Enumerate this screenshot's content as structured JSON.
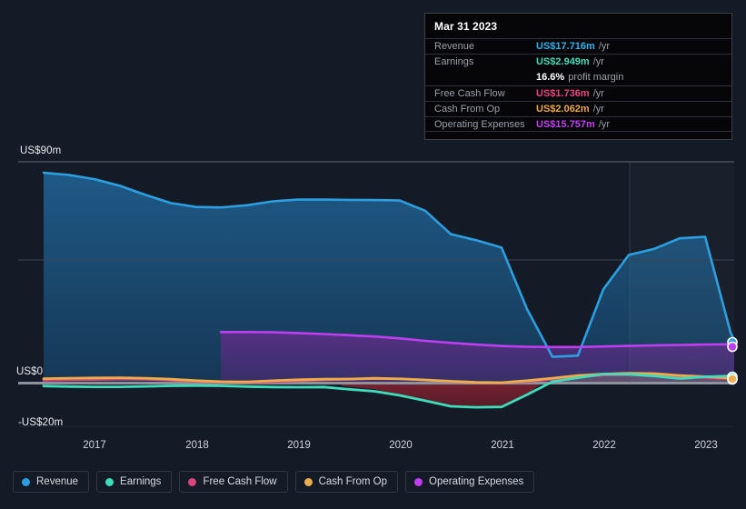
{
  "background": "#151b26",
  "axes": {
    "y_ticks": [
      {
        "label": "US$90m",
        "value": 90
      },
      {
        "label": "US$0",
        "value": 0
      },
      {
        "label": "-US$20m",
        "value": -20
      }
    ],
    "x_ticks": [
      "2017",
      "2018",
      "2019",
      "2020",
      "2021",
      "2022",
      "2023"
    ]
  },
  "tooltip": {
    "date": "Mar 31 2023",
    "rows": [
      {
        "key": "Revenue",
        "value": "US$17.716m",
        "unit": "/yr",
        "color": "#2db3ee"
      },
      {
        "key": "Earnings",
        "value": "US$2.949m",
        "unit": "/yr",
        "color": "#3ddcbb"
      },
      {
        "key": "",
        "value": "16.6%",
        "unit": "profit margin",
        "color": "#ffffff"
      },
      {
        "key": "Free Cash Flow",
        "value": "US$1.736m",
        "unit": "/yr",
        "color": "#e8457f"
      },
      {
        "key": "Cash From Op",
        "value": "US$2.062m",
        "unit": "/yr",
        "color": "#f0a83c"
      },
      {
        "key": "Operating Expenses",
        "value": "US$15.757m",
        "unit": "/yr",
        "color": "#c040f0"
      }
    ]
  },
  "legend": [
    {
      "label": "Revenue",
      "color": "#2b9fe0"
    },
    {
      "label": "Earnings",
      "color": "#3ddcbb"
    },
    {
      "label": "Free Cash Flow",
      "color": "#d9447c"
    },
    {
      "label": "Cash From Op",
      "color": "#efac4a"
    },
    {
      "label": "Operating Expenses",
      "color": "#bd3ff0"
    }
  ],
  "chart_data": {
    "type": "area",
    "title": "",
    "xlabel": "",
    "ylabel": "",
    "ylim": [
      -20,
      90
    ],
    "xlim": [
      2016.25,
      2023.3
    ],
    "grid": true,
    "legend_position": "bottom",
    "units": "US$ millions per year",
    "forecast_band_start": "2022.26",
    "x": [
      2016.25,
      2016.5,
      2016.75,
      2017.0,
      2017.25,
      2017.5,
      2017.75,
      2018.0,
      2018.25,
      2018.5,
      2018.75,
      2019.0,
      2019.25,
      2019.5,
      2019.75,
      2020.0,
      2020.25,
      2020.5,
      2020.75,
      2021.0,
      2021.25,
      2021.5,
      2021.75,
      2022.0,
      2022.25,
      2022.5,
      2022.75,
      2023.0,
      2023.25
    ],
    "series": [
      {
        "name": "Revenue",
        "color": "#2b9fe0",
        "fill": "#1c4a6e",
        "values": [
          85.5,
          84.6,
          82.9,
          80.2,
          76.5,
          73.2,
          71.6,
          71.4,
          72.3,
          73.9,
          74.6,
          74.6,
          74.5,
          74.4,
          74.2,
          70.0,
          60.5,
          58.0,
          55.0,
          30.0,
          10.5,
          11.0,
          38.0,
          52.0,
          54.5,
          58.8,
          59.5,
          20.5,
          17.716
        ]
      },
      {
        "name": "Earnings",
        "color": "#3ddcbb",
        "fill": "#7a2030",
        "values": [
          -1.2,
          -1.4,
          -1.5,
          -1.5,
          -1.3,
          -1.1,
          -1.0,
          -1.1,
          -1.4,
          -1.6,
          -1.7,
          -1.6,
          -1.4,
          -1.3,
          -2.6,
          -5.2,
          -7.4,
          -9.6,
          -10.0,
          -9.9,
          -5.0,
          -0.6,
          1.3,
          2.2,
          3.6,
          2.6,
          1.9,
          2.6,
          2.949
        ]
      },
      {
        "name": "Free Cash Flow",
        "color": "#d9447c",
        "fill": "#6d2236",
        "values": [
          1.1,
          1.3,
          1.4,
          1.6,
          1.5,
          1.2,
          0.7,
          0.4,
          0.3,
          0.5,
          0.9,
          1.3,
          1.5,
          1.7,
          1.7,
          1.6,
          1.2,
          0.7,
          0.3,
          0.2,
          0.7,
          1.5,
          2.5,
          3.2,
          3.4,
          2.7,
          2.2,
          2.0,
          1.736
        ]
      },
      {
        "name": "Cash From Op",
        "color": "#efac4a",
        "fill": "#6a4a22",
        "values": [
          1.8,
          2.0,
          2.1,
          2.2,
          2.0,
          1.6,
          1.0,
          0.6,
          0.5,
          0.8,
          1.3,
          1.7,
          1.9,
          2.0,
          2.0,
          1.9,
          1.5,
          1.0,
          0.6,
          0.5,
          1.0,
          2.0,
          3.0,
          3.7,
          4.0,
          3.2,
          2.7,
          2.4,
          2.062
        ]
      },
      {
        "name": "Operating Expenses",
        "color": "#bd3ff0",
        "fill": "#4a3070",
        "start_index": 8,
        "values": [
          null,
          null,
          null,
          null,
          null,
          null,
          null,
          null,
          20.8,
          20.8,
          20.7,
          20.4,
          20.0,
          19.5,
          19.0,
          18.2,
          17.2,
          16.4,
          15.7,
          15.1,
          14.8,
          14.7,
          14.7,
          14.9,
          15.1,
          15.3,
          15.5,
          15.65,
          15.757
        ]
      }
    ]
  }
}
